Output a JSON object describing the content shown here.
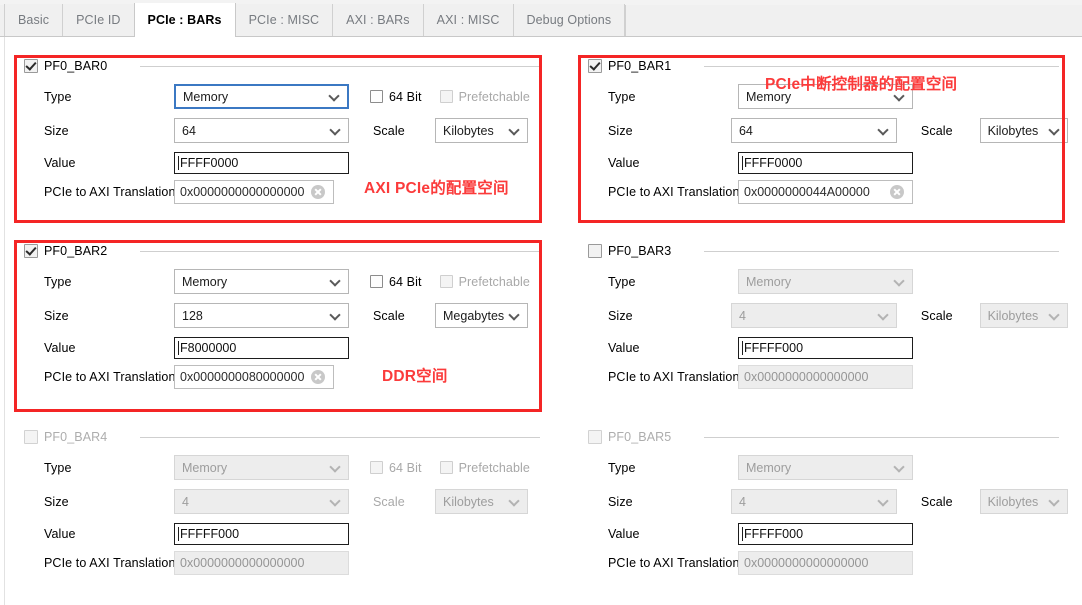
{
  "tabs": [
    {
      "label": "Basic",
      "active": false
    },
    {
      "label": "PCIe ID",
      "active": false
    },
    {
      "label": "PCIe : BARs",
      "active": true
    },
    {
      "label": "PCIe : MISC",
      "active": false
    },
    {
      "label": "AXI : BARs",
      "active": false
    },
    {
      "label": "AXI : MISC",
      "active": false
    },
    {
      "label": "Debug Options",
      "active": false
    }
  ],
  "labels": {
    "type": "Type",
    "size": "Size",
    "value": "Value",
    "translation": "PCIe to AXI Translation",
    "scale": "Scale",
    "bit64": "64 Bit",
    "prefetchable": "Prefetchable"
  },
  "bars": [
    {
      "title": "PF0_BAR0",
      "enabled": true,
      "type": "Memory",
      "size": "64",
      "scale": "Kilobytes",
      "value": "FFFF0000",
      "translation": "0x0000000000000000",
      "bit64_checked": false,
      "prefetchable_checked": false,
      "has_64bit_row": true,
      "type_focused": true,
      "has_clear_icon": true
    },
    {
      "title": "PF0_BAR1",
      "enabled": true,
      "type": "Memory",
      "size": "64",
      "scale": "Kilobytes",
      "value": "FFFF0000",
      "translation": "0x0000000044A00000",
      "bit64_checked": false,
      "prefetchable_checked": false,
      "has_64bit_row": false,
      "type_focused": false,
      "has_clear_icon": true
    },
    {
      "title": "PF0_BAR2",
      "enabled": true,
      "type": "Memory",
      "size": "128",
      "scale": "Megabytes",
      "value": "F8000000",
      "translation": "0x0000000080000000",
      "bit64_checked": false,
      "prefetchable_checked": false,
      "has_64bit_row": true,
      "type_focused": false,
      "has_clear_icon": true
    },
    {
      "title": "PF0_BAR3",
      "enabled": false,
      "type": "Memory",
      "size": "4",
      "scale": "Kilobytes",
      "value": "FFFFF000",
      "translation": "0x0000000000000000",
      "bit64_checked": false,
      "prefetchable_checked": false,
      "has_64bit_row": false,
      "type_focused": false,
      "has_clear_icon": false
    },
    {
      "title": "PF0_BAR4",
      "enabled": false,
      "type": "Memory",
      "size": "4",
      "scale": "Kilobytes",
      "value": "FFFFF000",
      "translation": "0x0000000000000000",
      "bit64_checked": false,
      "prefetchable_checked": false,
      "has_64bit_row": true,
      "type_focused": false,
      "has_clear_icon": false
    },
    {
      "title": "PF0_BAR5",
      "enabled": false,
      "type": "Memory",
      "size": "4",
      "scale": "Kilobytes",
      "value": "FFFFF000",
      "translation": "0x0000000000000000",
      "bit64_checked": false,
      "prefetchable_checked": false,
      "has_64bit_row": false,
      "type_focused": false,
      "has_clear_icon": false
    }
  ],
  "annotations": [
    {
      "text": "AXI PCIe的配置空间",
      "color": "#fb3b3b"
    },
    {
      "text": "PCIe中断控制器的配置空间",
      "color": "#fb3b3b"
    },
    {
      "text": "DDR空间",
      "color": "#fb3b3b"
    }
  ],
  "highlight_color": "#f42525"
}
